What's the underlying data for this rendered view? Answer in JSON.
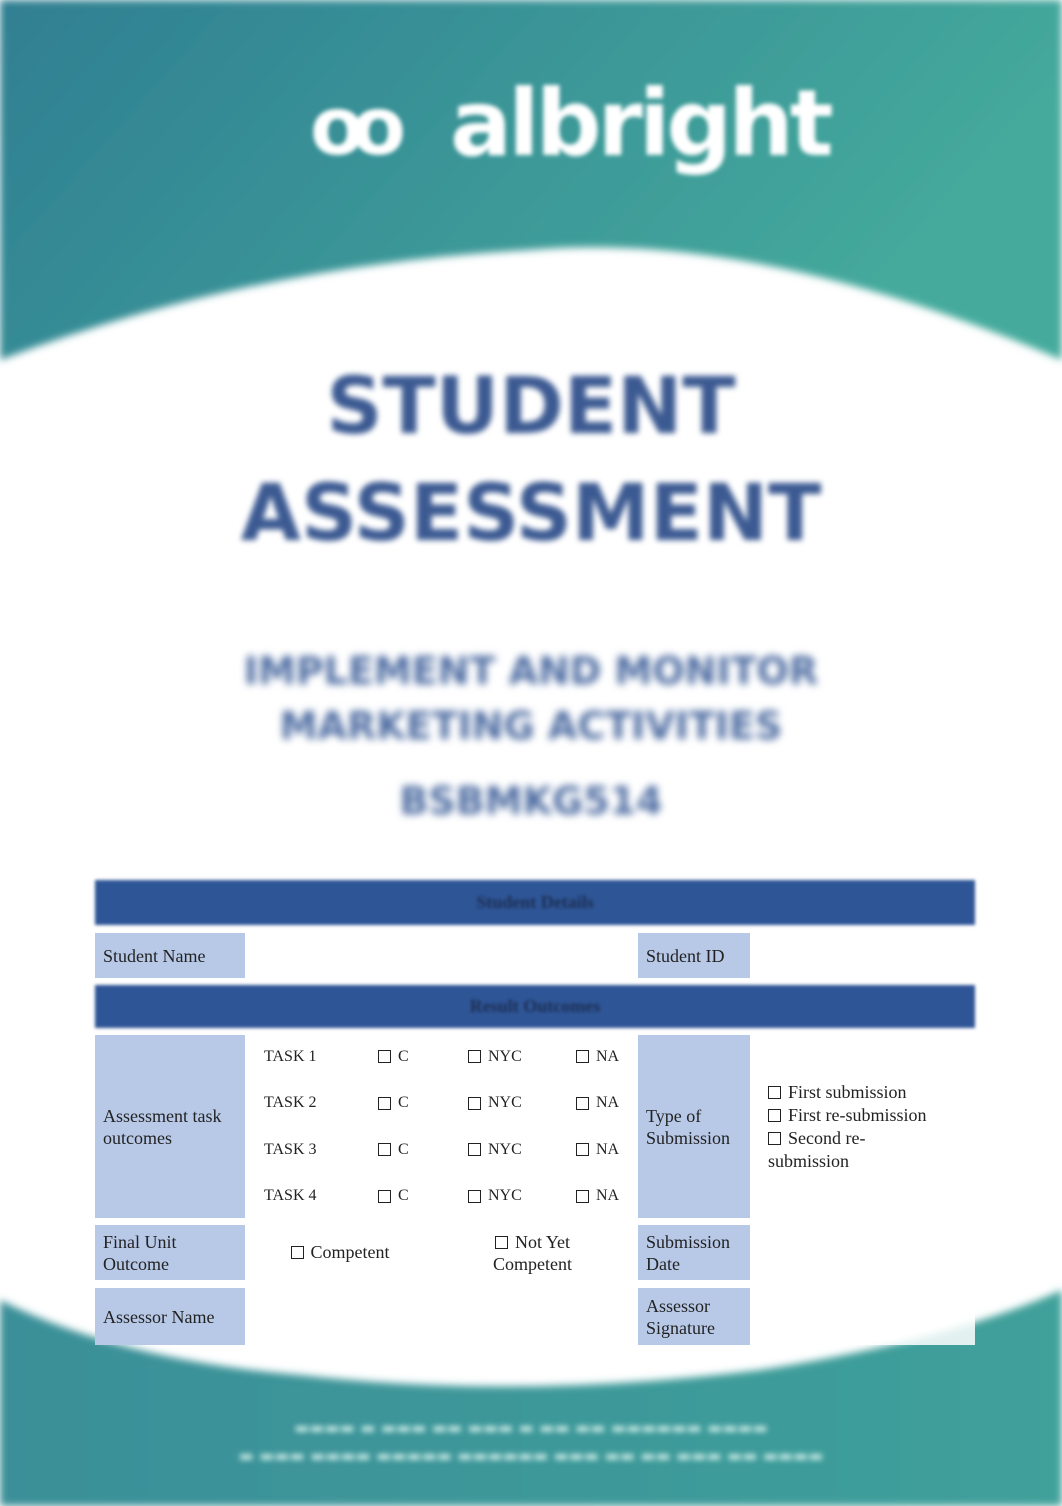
{
  "brand": {
    "logo_text": "albright",
    "colors": {
      "teal": "#3a9a9a",
      "navy": "#2e5596",
      "label_blue": "#b8c9e8"
    }
  },
  "document": {
    "title_line1": "STUDENT",
    "title_line2": "ASSESSMENT",
    "unit_line1": "IMPLEMENT AND MONITOR",
    "unit_line2": "MARKETING ACTIVITIES",
    "unit_code": "BSBMKG514"
  },
  "form": {
    "section1_header": "Student Details",
    "student_name_label": "Student Name",
    "student_id_label": "Student ID",
    "section2_header": "Result Outcomes",
    "outcomes_label": "Assessment task outcomes",
    "tasks": [
      {
        "name": "TASK 1",
        "c": "C",
        "nyc": "NYC",
        "na": "NA"
      },
      {
        "name": "TASK 2",
        "c": "C",
        "nyc": "NYC",
        "na": "NA"
      },
      {
        "name": "TASK 3",
        "c": "C",
        "nyc": "NYC",
        "na": "NA"
      },
      {
        "name": "TASK 4",
        "c": "C",
        "nyc": "NYC",
        "na": "NA"
      }
    ],
    "submission_type_label": "Type of Submission",
    "submission_options": [
      "First submission",
      "First re-submission",
      "Second re-submission"
    ],
    "final_outcome_label": "Final Unit Outcome",
    "competent": "Competent",
    "not_yet_competent": "Not Yet Competent",
    "submission_date_label": "Submission Date",
    "assessor_name_label": "Assessor Name",
    "assessor_signature_label": "Assessor Signature"
  }
}
